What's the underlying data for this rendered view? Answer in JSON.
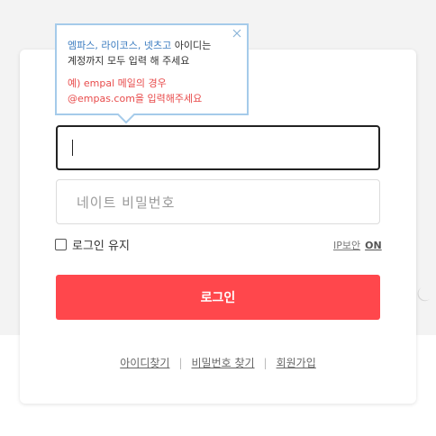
{
  "tooltip": {
    "line1_brand1": "엠파스",
    "line1_brand2": "라이코스",
    "line1_brand3": "넷츠고",
    "line1_rest": " 아이디는",
    "line2": "계정까지 모두 입력 해 주세요",
    "note_line1": "예) empal 메일의 경우",
    "note_line2": "@empas.com을 입력해주세요",
    "icon": "close-icon"
  },
  "form": {
    "password_placeholder": "네이트 비밀번호",
    "keep_login_label": "로그인 유지",
    "ip_security_label": "IP보안",
    "ip_security_state": "ON",
    "login_button": "로그인"
  },
  "links": {
    "find_id": "아이디찾기",
    "find_password": "비밀번호 찾기",
    "signup": "회원가입"
  },
  "colors": {
    "accent": "#ff474c",
    "tooltip_border": "#a5cbea",
    "tooltip_highlight": "#3b7cc0",
    "note_red": "#e84b4b"
  }
}
